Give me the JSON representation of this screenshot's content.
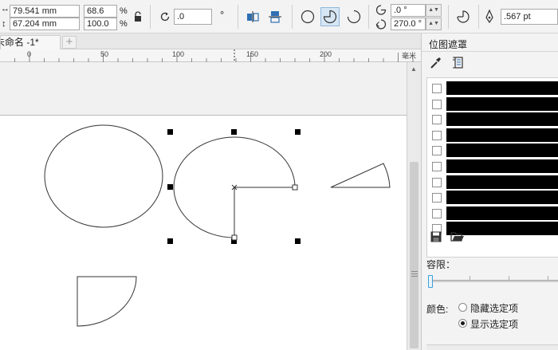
{
  "property_bar": {
    "width_value": "79.541 mm",
    "height_value": "67.204 mm",
    "scale_x": "68.6",
    "scale_y": "100.0",
    "percent_symbol": "%",
    "rotation_value": ".0",
    "start_angle": ".0 °",
    "end_angle": "270.0 °",
    "outline_width": ".567 pt"
  },
  "tabs": {
    "document_tab": "未命名 -1*",
    "add_tab_symbol": "+"
  },
  "ruler": {
    "ticks": [
      "0",
      "50",
      "100",
      "150",
      "200"
    ],
    "unit": "毫米"
  },
  "docker": {
    "title": "位图遮罩",
    "tolerance_label": "容限：",
    "color_label": "颜色:",
    "hide_option": "隐藏选定项",
    "show_option": "显示选定项",
    "selected_option": "显示选定项",
    "tolerance_level": 0,
    "color_rows": [
      {
        "checked": false,
        "color": "#000000"
      },
      {
        "checked": false,
        "color": "#000000"
      },
      {
        "checked": false,
        "color": "#000000"
      },
      {
        "checked": false,
        "color": "#000000"
      },
      {
        "checked": false,
        "color": "#000000"
      },
      {
        "checked": false,
        "color": "#000000"
      },
      {
        "checked": false,
        "color": "#000000"
      },
      {
        "checked": false,
        "color": "#000000"
      },
      {
        "checked": false,
        "color": "#000000"
      },
      {
        "checked": false,
        "color": "#000000"
      }
    ]
  },
  "colors": {
    "selection_accent": "#3ea0da",
    "handle": "#000000"
  }
}
